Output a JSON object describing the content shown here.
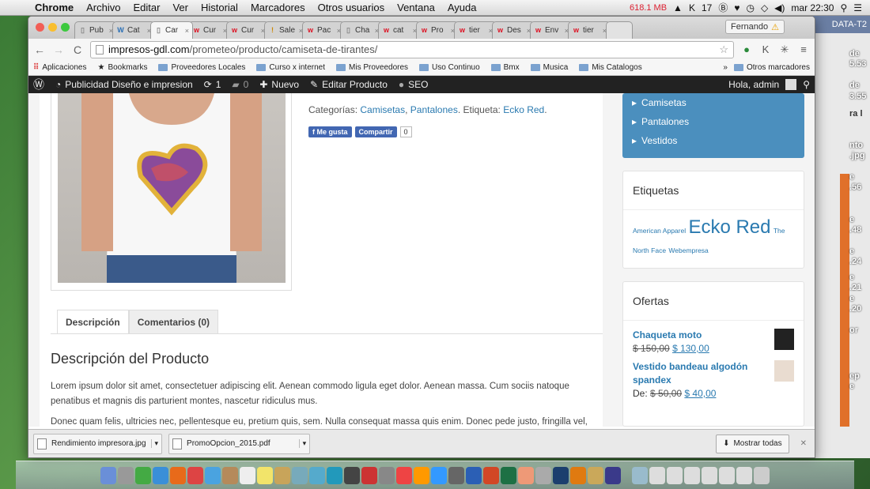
{
  "menubar": {
    "items": [
      "Chrome",
      "Archivo",
      "Editar",
      "Ver",
      "Historial",
      "Marcadores",
      "Otros usuarios",
      "Ventana",
      "Ayuda"
    ],
    "memory": "618.1 MB",
    "badge_count": "17",
    "clock": "mar 22:30"
  },
  "bg_window": {
    "title": "DATA-T2",
    "labels": [
      "de",
      "5.53",
      "de",
      "3.55",
      "ra l",
      "nto",
      ".jpg",
      "e",
      ".56",
      "e",
      ".48",
      "e",
      ".24",
      "e",
      ".21",
      "e",
      ".20",
      "or",
      "ep",
      "e",
      ".48"
    ]
  },
  "browser": {
    "tabs": [
      {
        "icon": "page-icon",
        "label": "Pub"
      },
      {
        "icon": "wp-icon",
        "label": "Cat"
      },
      {
        "icon": "page-icon",
        "label": "Car"
      },
      {
        "icon": "w-icon",
        "label": "Cur"
      },
      {
        "icon": "w-icon",
        "label": "Cur"
      },
      {
        "icon": "exclaim-icon",
        "label": "Sale"
      },
      {
        "icon": "w-icon",
        "label": "Pac"
      },
      {
        "icon": "page-icon",
        "label": "Cha"
      },
      {
        "icon": "w-icon",
        "label": "cat"
      },
      {
        "icon": "w-icon",
        "label": "Pro"
      },
      {
        "icon": "w-icon",
        "label": "tier"
      },
      {
        "icon": "w-icon",
        "label": "Des"
      },
      {
        "icon": "w-icon",
        "label": "Env"
      },
      {
        "icon": "w-icon",
        "label": "tier"
      }
    ],
    "profile": "Fernando",
    "url_host": "impresos-gdl.com",
    "url_path": "/prometeo/producto/camiseta-de-tirantes/",
    "bookmarks": [
      "Aplicaciones",
      "Bookmarks",
      "Proveedores Locales",
      "Curso x internet",
      "Mis Proveedores",
      "Uso Continuo",
      "Bmx",
      "Musica",
      "Mis Catalogos"
    ],
    "other_bookmarks": "Otros marcadores"
  },
  "adminbar": {
    "site": "Publicidad Diseño e impresion",
    "updates": "1",
    "comments": "0",
    "new": "Nuevo",
    "edit": "Editar Producto",
    "seo": "SEO",
    "greeting": "Hola, admin"
  },
  "product": {
    "categories_label": "Categorías:",
    "cat1": "Camisetas",
    "sep": ",",
    "cat2": "Pantalones",
    "tag_label": ". Etiqueta:",
    "tag": "Ecko Red",
    "tag_end": ".",
    "like": "Me gusta",
    "share": "Compartir",
    "share_count": "0",
    "tabs": [
      "Descripción",
      "Comentarios (0)"
    ],
    "desc_title": "Descripción del Producto",
    "desc_p1": "Lorem ipsum dolor sit amet, consectetuer adipiscing elit. Aenean commodo ligula eget dolor. Aenean massa. Cum sociis natoque penatibus et magnis dis parturient montes, nascetur ridiculus mus.",
    "desc_p2": "Donec quam felis, ultricies nec, pellentesque eu, pretium quis, sem. Nulla consequat massa quis enim. Donec pede justo, fringilla vel,"
  },
  "sidebar": {
    "categories": [
      "Camisetas",
      "Pantalones",
      "Vestidos"
    ],
    "tags_title": "Etiquetas",
    "tags": [
      {
        "label": "American Apparel",
        "size": "sm"
      },
      {
        "label": "Ecko Red",
        "size": "lg"
      },
      {
        "label": "The North Face",
        "size": "sm"
      },
      {
        "label": "Webempresa",
        "size": "sm"
      }
    ],
    "offers_title": "Ofertas",
    "offers": [
      {
        "name": "Chaqueta moto",
        "prefix": "",
        "old": "$ 150,00",
        "new": "$ 130,00"
      },
      {
        "name": "Vestido bandeau algodón spandex",
        "prefix": "De: ",
        "old": "$ 50,00",
        "new": "$ 40,00"
      }
    ]
  },
  "downloads": {
    "items": [
      "Rendimiento impresora.jpg",
      "PromoOpcion_2015.pdf"
    ],
    "show_all": "Mostrar todas"
  },
  "colors": {
    "wp_blue": "#4b8fbe",
    "link": "#2a7ab0",
    "adminbar": "#222222",
    "fb": "#4267b2"
  }
}
